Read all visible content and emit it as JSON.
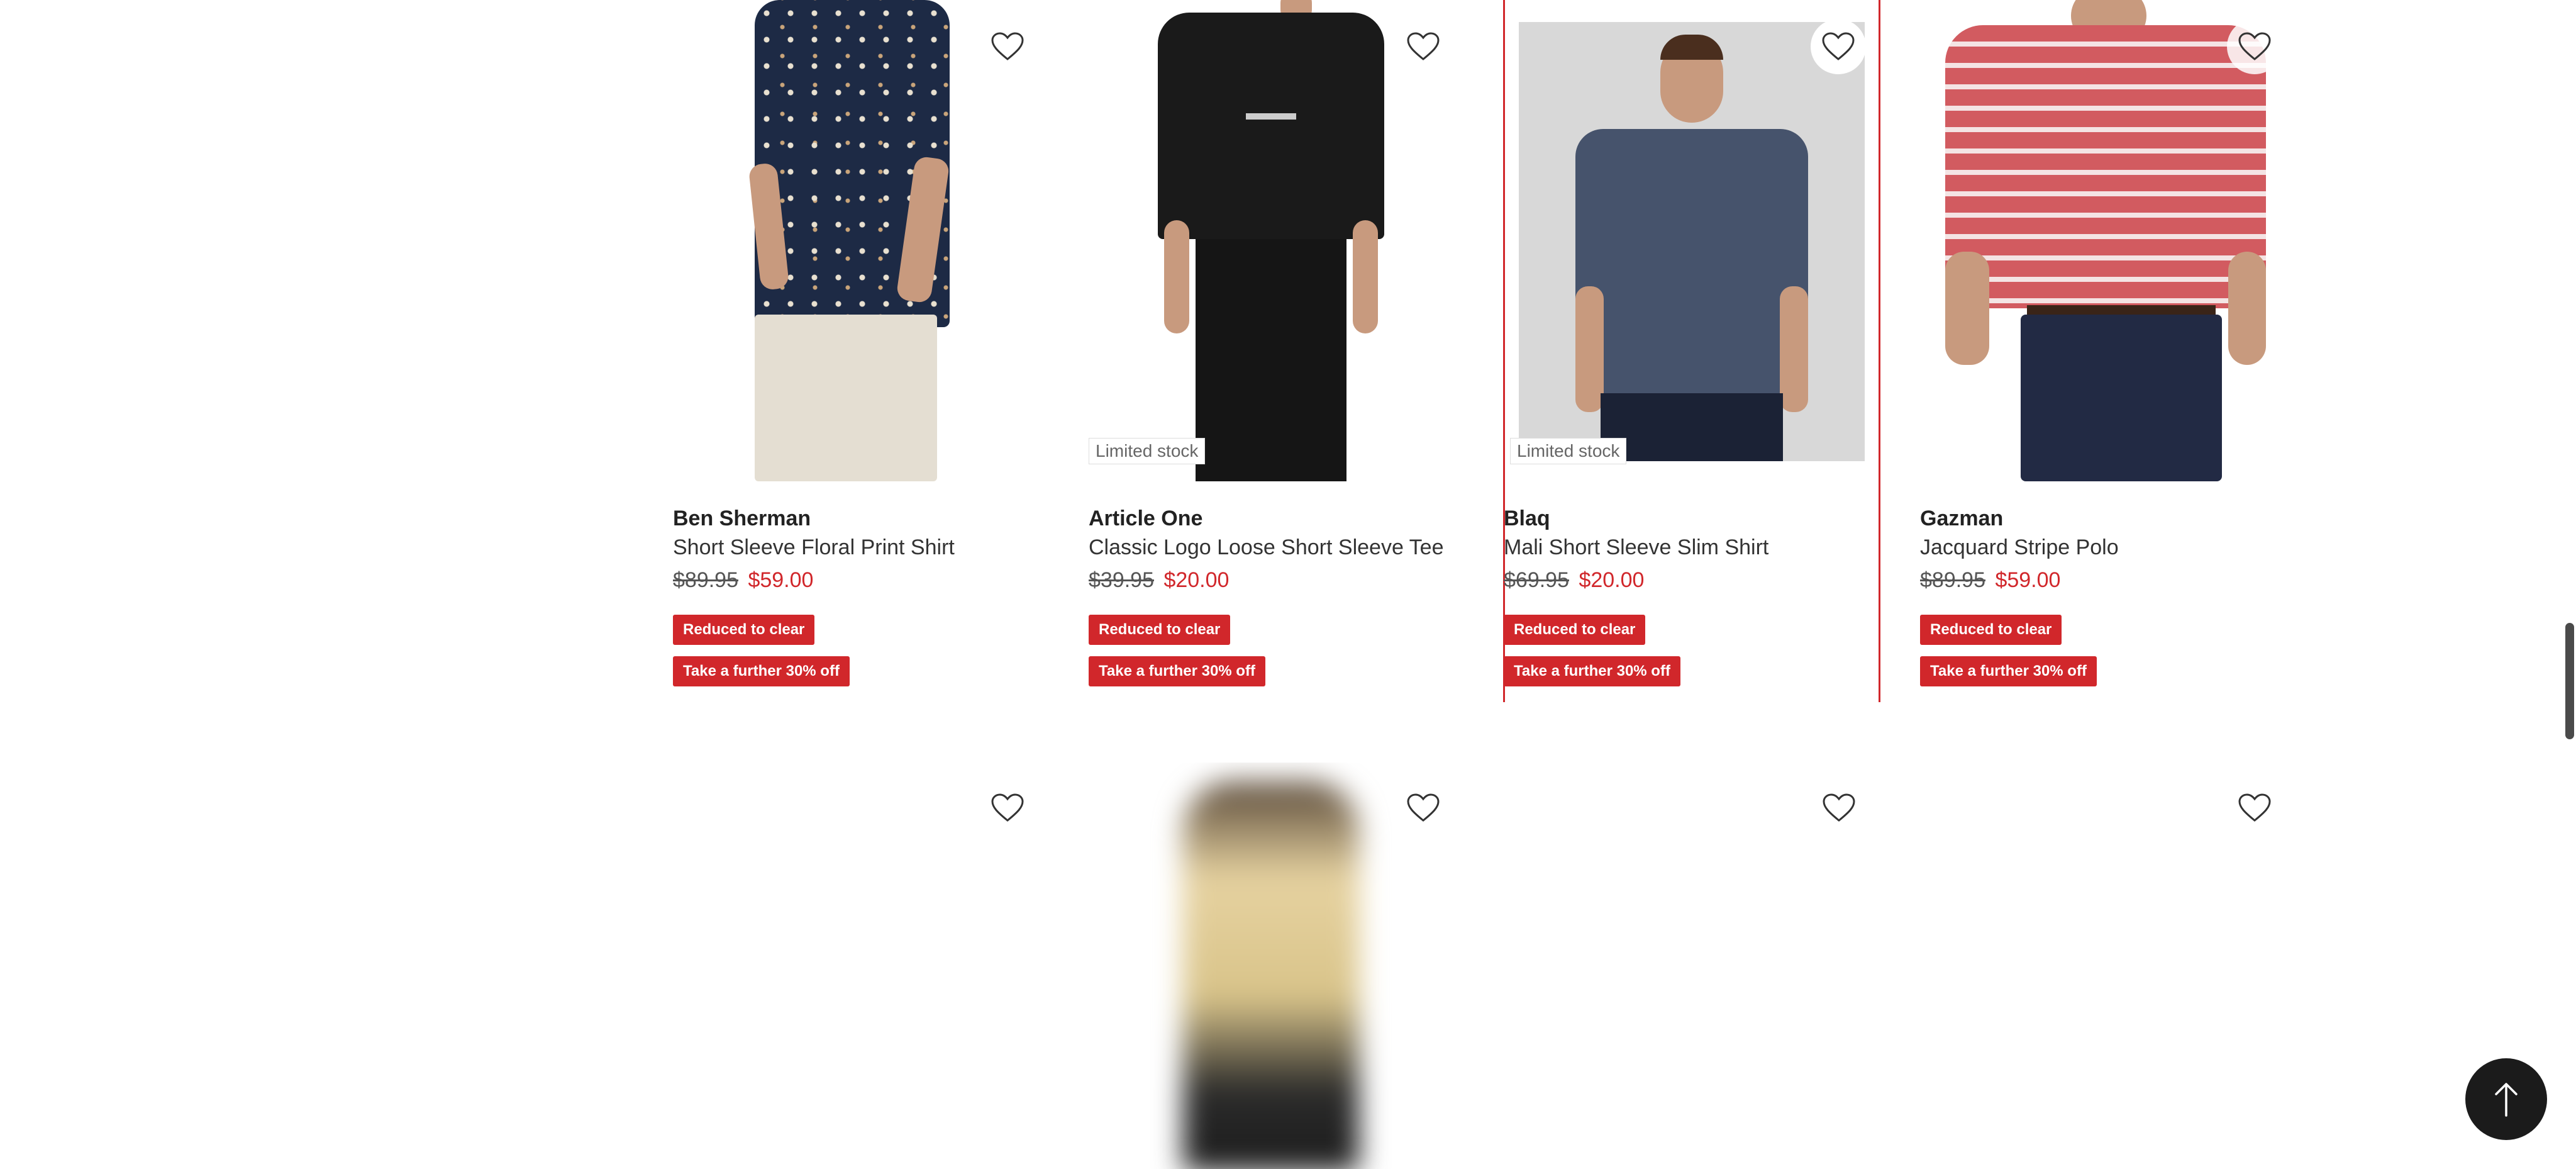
{
  "products": [
    {
      "brand": "Ben Sherman",
      "name": "Short Sleeve Floral Print Shirt",
      "was_price": "$89.95",
      "now_price": "$59.00",
      "badges": [
        "Reduced to clear",
        "Take a further 30% off"
      ],
      "stock_tag": "",
      "wishlist_icon": "heart-outline-icon"
    },
    {
      "brand": "Article One",
      "name": "Classic Logo Loose Short Sleeve Tee",
      "was_price": "$39.95",
      "now_price": "$20.00",
      "badges": [
        "Reduced to clear",
        "Take a further 30% off"
      ],
      "stock_tag": "Limited stock",
      "wishlist_icon": "heart-outline-icon"
    },
    {
      "brand": "Blaq",
      "name": "Mali Short Sleeve Slim Shirt",
      "was_price": "$69.95",
      "now_price": "$20.00",
      "badges": [
        "Reduced to clear",
        "Take a further 30% off"
      ],
      "stock_tag": "Limited stock",
      "wishlist_icon": "heart-outline-icon"
    },
    {
      "brand": "Gazman",
      "name": "Jacquard Stripe Polo",
      "was_price": "$89.95",
      "now_price": "$59.00",
      "badges": [
        "Reduced to clear",
        "Take a further 30% off"
      ],
      "stock_tag": "",
      "wishlist_icon": "heart-outline-icon"
    }
  ],
  "next_row": {
    "wishlist_icon": "heart-outline-icon",
    "count": 4
  },
  "back_to_top": {
    "icon": "arrow-up-icon"
  },
  "colors": {
    "sale_red": "#d1272b",
    "text_dark": "#222222",
    "back_to_top_bg": "#1b1b1b"
  }
}
